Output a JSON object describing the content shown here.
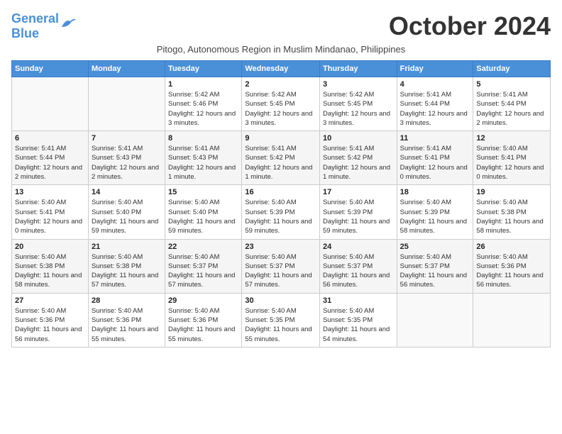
{
  "logo": {
    "line1": "General",
    "line2": "Blue"
  },
  "title": "October 2024",
  "subtitle": "Pitogo, Autonomous Region in Muslim Mindanao, Philippines",
  "headers": [
    "Sunday",
    "Monday",
    "Tuesday",
    "Wednesday",
    "Thursday",
    "Friday",
    "Saturday"
  ],
  "weeks": [
    [
      {
        "day": "",
        "info": ""
      },
      {
        "day": "",
        "info": ""
      },
      {
        "day": "1",
        "info": "Sunrise: 5:42 AM\nSunset: 5:46 PM\nDaylight: 12 hours and 3 minutes."
      },
      {
        "day": "2",
        "info": "Sunrise: 5:42 AM\nSunset: 5:45 PM\nDaylight: 12 hours and 3 minutes."
      },
      {
        "day": "3",
        "info": "Sunrise: 5:42 AM\nSunset: 5:45 PM\nDaylight: 12 hours and 3 minutes."
      },
      {
        "day": "4",
        "info": "Sunrise: 5:41 AM\nSunset: 5:44 PM\nDaylight: 12 hours and 3 minutes."
      },
      {
        "day": "5",
        "info": "Sunrise: 5:41 AM\nSunset: 5:44 PM\nDaylight: 12 hours and 2 minutes."
      }
    ],
    [
      {
        "day": "6",
        "info": "Sunrise: 5:41 AM\nSunset: 5:44 PM\nDaylight: 12 hours and 2 minutes."
      },
      {
        "day": "7",
        "info": "Sunrise: 5:41 AM\nSunset: 5:43 PM\nDaylight: 12 hours and 2 minutes."
      },
      {
        "day": "8",
        "info": "Sunrise: 5:41 AM\nSunset: 5:43 PM\nDaylight: 12 hours and 1 minute."
      },
      {
        "day": "9",
        "info": "Sunrise: 5:41 AM\nSunset: 5:42 PM\nDaylight: 12 hours and 1 minute."
      },
      {
        "day": "10",
        "info": "Sunrise: 5:41 AM\nSunset: 5:42 PM\nDaylight: 12 hours and 1 minute."
      },
      {
        "day": "11",
        "info": "Sunrise: 5:41 AM\nSunset: 5:41 PM\nDaylight: 12 hours and 0 minutes."
      },
      {
        "day": "12",
        "info": "Sunrise: 5:40 AM\nSunset: 5:41 PM\nDaylight: 12 hours and 0 minutes."
      }
    ],
    [
      {
        "day": "13",
        "info": "Sunrise: 5:40 AM\nSunset: 5:41 PM\nDaylight: 12 hours and 0 minutes."
      },
      {
        "day": "14",
        "info": "Sunrise: 5:40 AM\nSunset: 5:40 PM\nDaylight: 11 hours and 59 minutes."
      },
      {
        "day": "15",
        "info": "Sunrise: 5:40 AM\nSunset: 5:40 PM\nDaylight: 11 hours and 59 minutes."
      },
      {
        "day": "16",
        "info": "Sunrise: 5:40 AM\nSunset: 5:39 PM\nDaylight: 11 hours and 59 minutes."
      },
      {
        "day": "17",
        "info": "Sunrise: 5:40 AM\nSunset: 5:39 PM\nDaylight: 11 hours and 59 minutes."
      },
      {
        "day": "18",
        "info": "Sunrise: 5:40 AM\nSunset: 5:39 PM\nDaylight: 11 hours and 58 minutes."
      },
      {
        "day": "19",
        "info": "Sunrise: 5:40 AM\nSunset: 5:38 PM\nDaylight: 11 hours and 58 minutes."
      }
    ],
    [
      {
        "day": "20",
        "info": "Sunrise: 5:40 AM\nSunset: 5:38 PM\nDaylight: 11 hours and 58 minutes."
      },
      {
        "day": "21",
        "info": "Sunrise: 5:40 AM\nSunset: 5:38 PM\nDaylight: 11 hours and 57 minutes."
      },
      {
        "day": "22",
        "info": "Sunrise: 5:40 AM\nSunset: 5:37 PM\nDaylight: 11 hours and 57 minutes."
      },
      {
        "day": "23",
        "info": "Sunrise: 5:40 AM\nSunset: 5:37 PM\nDaylight: 11 hours and 57 minutes."
      },
      {
        "day": "24",
        "info": "Sunrise: 5:40 AM\nSunset: 5:37 PM\nDaylight: 11 hours and 56 minutes."
      },
      {
        "day": "25",
        "info": "Sunrise: 5:40 AM\nSunset: 5:37 PM\nDaylight: 11 hours and 56 minutes."
      },
      {
        "day": "26",
        "info": "Sunrise: 5:40 AM\nSunset: 5:36 PM\nDaylight: 11 hours and 56 minutes."
      }
    ],
    [
      {
        "day": "27",
        "info": "Sunrise: 5:40 AM\nSunset: 5:36 PM\nDaylight: 11 hours and 56 minutes."
      },
      {
        "day": "28",
        "info": "Sunrise: 5:40 AM\nSunset: 5:36 PM\nDaylight: 11 hours and 55 minutes."
      },
      {
        "day": "29",
        "info": "Sunrise: 5:40 AM\nSunset: 5:36 PM\nDaylight: 11 hours and 55 minutes."
      },
      {
        "day": "30",
        "info": "Sunrise: 5:40 AM\nSunset: 5:35 PM\nDaylight: 11 hours and 55 minutes."
      },
      {
        "day": "31",
        "info": "Sunrise: 5:40 AM\nSunset: 5:35 PM\nDaylight: 11 hours and 54 minutes."
      },
      {
        "day": "",
        "info": ""
      },
      {
        "day": "",
        "info": ""
      }
    ]
  ]
}
